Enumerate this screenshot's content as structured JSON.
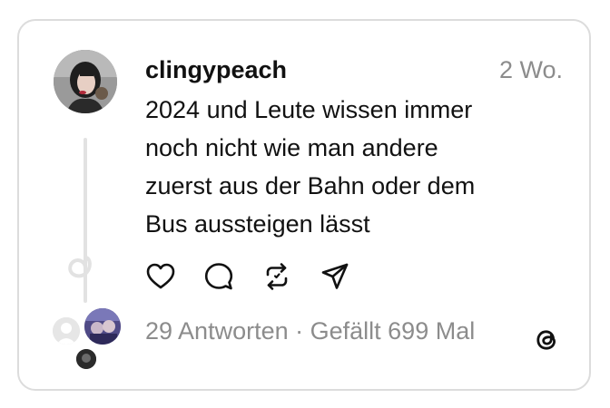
{
  "post": {
    "username": "clingypeach",
    "time": "2 Wo.",
    "text": "2024 und Leute wissen immer\nnoch nicht wie man andere\nzuerst aus der Bahn oder dem\nBus aussteigen lässt",
    "replies": "29 Antworten",
    "separator": " · ",
    "likes": "Gefällt 699 Mal"
  },
  "actions": [
    "heart-icon",
    "comment-icon",
    "repost-icon",
    "share-icon"
  ],
  "icons": {
    "brand": "threads-logo-icon"
  },
  "colors": {
    "text": "#111111",
    "muted": "#8c8c8c",
    "border": "#dcdcdc",
    "thread_line": "#e2e2e2"
  }
}
